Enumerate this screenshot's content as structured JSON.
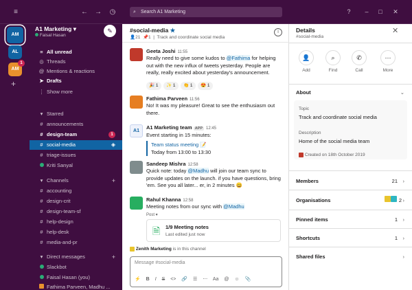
{
  "topbar": {
    "search_placeholder": "Search A1 Marketing",
    "help": "?",
    "minimize": "–",
    "maximize": "□",
    "close": "✕"
  },
  "rail": {
    "workspaces": [
      {
        "initials": "AM",
        "color": "#1164a3",
        "badge": ""
      },
      {
        "initials": "AL",
        "color": "#1164a3",
        "badge": ""
      },
      {
        "initials": "AM",
        "color": "#e8912d",
        "badge": "1"
      }
    ],
    "add": "+"
  },
  "sidebar": {
    "workspace_name": "A1 Marketing",
    "user_name": "Faisal Hasan",
    "top_items": [
      {
        "icon": "≡",
        "label": "All unread"
      },
      {
        "icon": "◎",
        "label": "Threads"
      },
      {
        "icon": "@",
        "label": "Mentions & reactions"
      },
      {
        "icon": "➤",
        "label": "Drafts"
      },
      {
        "icon": "⋮",
        "label": "Show more"
      }
    ],
    "starred_header": "Starred",
    "starred": [
      {
        "label": "announcements"
      },
      {
        "label": "design-team",
        "badge": "1"
      },
      {
        "label": "social-media"
      },
      {
        "label": "triage-issues"
      },
      {
        "label": "Kriti Sanyal"
      }
    ],
    "channels_header": "Channels",
    "channels": [
      {
        "label": "accounting"
      },
      {
        "label": "design-crit"
      },
      {
        "label": "design-team-sf"
      },
      {
        "label": "help-design"
      },
      {
        "label": "help-desk"
      },
      {
        "label": "media-and-pr"
      }
    ],
    "dm_header": "Direct messages",
    "dms": [
      {
        "label": "Slackbot"
      },
      {
        "label": "Faisal Hasan (you)"
      },
      {
        "label": "Fathima Parveen, Madhu ..."
      }
    ]
  },
  "channel": {
    "name": "#social-media",
    "members": "21",
    "pins": "1",
    "topic": "Track and coordinate social media"
  },
  "messages": [
    {
      "name": "Geeta Joshi",
      "time": "11:55",
      "color": "#c0392b",
      "lines": [
        "Really need to give some kudos to ",
        "@Fathima",
        " for helping out with the new influx of tweets yesterday. People are really, really excited about yesterday's announcement."
      ]
    },
    {
      "name": "Fathima Parveen",
      "time": "11:56",
      "color": "#e67e22",
      "text": "No! It was my pleasure! Great to see the enthusiasm out there."
    },
    {
      "name": "A1 Marketing team",
      "tag": "APP",
      "time": "12:45",
      "text": "Event starting in 15 minutes:",
      "event_title": "Team status meeting",
      "event_time": "Today from 13:00 to 13:30"
    },
    {
      "name": "Sandeep Mishra",
      "time": "12:58",
      "color": "#7f8c8d",
      "parts": [
        "Quick note: today ",
        "@Madhu",
        " will join our team sync to provide updates on the launch. if you have questions, bring 'em. See you all later... er, in 2 minutes 😄"
      ]
    },
    {
      "name": "Rahul Khanna",
      "time": "12:58",
      "color": "#27ae60",
      "parts": [
        "Meeting notes from our sync with ",
        "@Madhu"
      ],
      "post_label": "Post",
      "post_title": "1/9 Meeting notes",
      "post_sub": "Last edited just now"
    }
  ],
  "reactions": [
    {
      "emoji": "🎉",
      "count": "1"
    },
    {
      "emoji": "✨",
      "count": "1"
    },
    {
      "emoji": "👏",
      "count": "1"
    },
    {
      "emoji": "😍",
      "count": "1"
    }
  ],
  "channel_note": {
    "name": "Zenith Marketing",
    "text": " is in this channel"
  },
  "composer": {
    "placeholder": "Message #social-media"
  },
  "details": {
    "title": "Details",
    "subtitle": "#social-media",
    "actions": [
      {
        "icon": "👤",
        "label": "Add"
      },
      {
        "icon": "⌕",
        "label": "Find"
      },
      {
        "icon": "✆",
        "label": "Call"
      },
      {
        "icon": "⋯",
        "label": "More"
      }
    ],
    "about_label": "About",
    "topic_label": "Topic",
    "topic": "Track and coordinate social media",
    "description_label": "Description",
    "description": "Home of the social media team",
    "created": "Created on 18th October 2019",
    "rows": [
      {
        "label": "Members",
        "count": "21"
      },
      {
        "label": "Organisations",
        "count": "2"
      },
      {
        "label": "Pinned items",
        "count": "1"
      },
      {
        "label": "Shortcuts",
        "count": "1"
      },
      {
        "label": "Shared files",
        "count": ""
      }
    ]
  }
}
